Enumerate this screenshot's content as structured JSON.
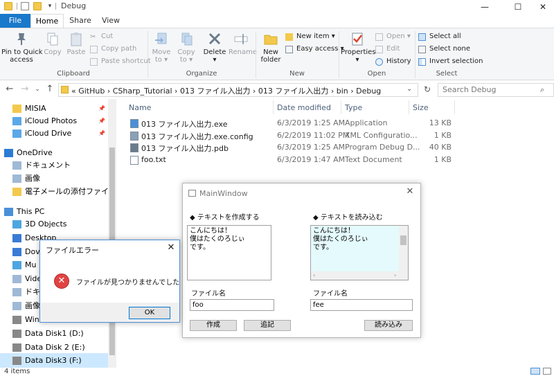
{
  "titlebar": {
    "title": "Debug",
    "minimize": "—",
    "maximize": "☐",
    "close": "✕"
  },
  "ribbon_tabs": {
    "file": "File",
    "home": "Home",
    "share": "Share",
    "view": "View"
  },
  "ribbon": {
    "clipboard": {
      "pin": "Pin to Quick\naccess",
      "copy": "Copy",
      "paste": "Paste",
      "cut": "Cut",
      "copy_path": "Copy path",
      "paste_shortcut": "Paste shortcut",
      "label": "Clipboard"
    },
    "organize": {
      "move_to": "Move\nto ▾",
      "copy_to": "Copy\nto ▾",
      "delete": "Delete\n▾",
      "rename": "Rename",
      "label": "Organize"
    },
    "new": {
      "new_folder": "New\nfolder",
      "new_item": "New item ▾",
      "easy_access": "Easy access ▾",
      "label": "New"
    },
    "open": {
      "properties": "Properties\n▾",
      "open": "Open ▾",
      "edit": "Edit",
      "history": "History",
      "label": "Open"
    },
    "select": {
      "select_all": "Select all",
      "select_none": "Select none",
      "invert": "Invert selection",
      "label": "Select"
    }
  },
  "address": {
    "path": "«  GitHub  ›  CSharp_Tutorial  ›  013 ファイル入出力  ›  013 ファイル入出力  ›  bin  ›  Debug",
    "search_placeholder": "Search Debug"
  },
  "nav": [
    {
      "label": "MISIA",
      "pinned": true
    },
    {
      "label": "iCloud Photos",
      "pinned": true
    },
    {
      "label": "iCloud Drive",
      "pinned": true
    },
    {
      "label": "OneDrive"
    },
    {
      "label": "ドキュメント"
    },
    {
      "label": "画像"
    },
    {
      "label": "電子メールの添付ファイル"
    },
    {
      "label": "This PC"
    },
    {
      "label": "3D Objects"
    },
    {
      "label": "Desktop"
    },
    {
      "label": "Dov"
    },
    {
      "label": "Mu"
    },
    {
      "label": "Vide"
    },
    {
      "label": "ドキ"
    },
    {
      "label": "画像"
    },
    {
      "label": "Win"
    },
    {
      "label": "Data Disk1 (D:)"
    },
    {
      "label": "Data Disk 2 (E:)"
    },
    {
      "label": "Data Disk3 (F:)"
    }
  ],
  "columns": {
    "name": "Name",
    "date": "Date modified",
    "type": "Type",
    "size": "Size"
  },
  "files": [
    {
      "name": "013 ファイル入出力.exe",
      "date": "6/3/2019 1:25 AM",
      "type": "Application",
      "size": "13 KB"
    },
    {
      "name": "013 ファイル入出力.exe.config",
      "date": "6/2/2019 11:02 PM",
      "type": "XML Configuratio...",
      "size": "1 KB"
    },
    {
      "name": "013 ファイル入出力.pdb",
      "date": "6/3/2019 1:25 AM",
      "type": "Program Debug D...",
      "size": "40 KB"
    },
    {
      "name": "foo.txt",
      "date": "6/3/2019 1:47 AM",
      "type": "Text Document",
      "size": "1 KB"
    }
  ],
  "status": {
    "items": "4 items"
  },
  "mainwindow": {
    "title": "MainWindow",
    "close": "✕",
    "left": {
      "header": "◆ テキストを作成する",
      "text": "こんにちは！\n僕はたくのろじぃ\nです。",
      "filename_label": "ファイル名",
      "filename": "foo",
      "btn_create": "作成",
      "btn_append": "追記"
    },
    "right": {
      "header": "◆ テキストを読み込む",
      "text": "こんにちは！\n僕はたくのろじぃ\nです。",
      "filename_label": "ファイル名",
      "filename": "fee",
      "btn_read": "読み込み"
    }
  },
  "error_dialog": {
    "title": "ファイルエラー",
    "close": "✕",
    "message": "ファイルが見つかりませんでした",
    "ok": "OK"
  }
}
